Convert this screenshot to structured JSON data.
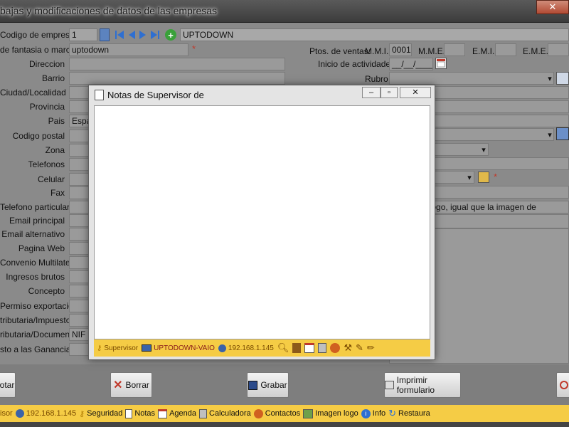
{
  "window": {
    "title": "bajas y modificaciones de datos de las empresas",
    "close": "✕"
  },
  "form": {
    "labels": {
      "codigo": "Codigo  de empresa",
      "fantasia": "de fantasia o marca",
      "direccion": "Direccion",
      "barrio": "Barrio",
      "ciudad": "Ciudad/Localidad",
      "provincia": "Provincia",
      "pais": "Pais",
      "cp": "Codigo postal",
      "zona": "Zona",
      "telefonos": "Telefonos",
      "celular": "Celular",
      "fax": "Fax",
      "tel_particular": "Telefono particular",
      "email_principal": "Email principal",
      "email_alt": "Email alternativo",
      "web": "Pagina Web",
      "convenio": "Convenio Multilateral",
      "ingresos": "Ingresos brutos",
      "concepto": "Concepto",
      "permiso": "Permiso exportacion",
      "tributaria": "tributaria/Impuesto",
      "documento": "ributaria/Documento",
      "ganancias": "sto a las Ganancias",
      "ptos": "Ptos. de ventas:",
      "mmi": "M.M.I.",
      "mme": "M.M.E.",
      "emi": "E.M.I.",
      "eme": "E.M.E.",
      "inicio": "Inicio de actividades",
      "rubro": "Rubro"
    },
    "values": {
      "codigo": "1",
      "empresa_name": "UPTODOWN",
      "fantasia": "uptodown",
      "pais": "Espa",
      "mmi": "0001",
      "fecha": "__/__/____",
      "documento": "NIF",
      "logo_text": "emplo de logo, igual que la imagen de"
    },
    "required_mark": "*"
  },
  "modal": {
    "title": "Notas de Supervisor de",
    "status": {
      "user": "Supervisor",
      "pc": "UPTODOWN-VAIO",
      "ip": "192.168.1.145"
    }
  },
  "buttons": {
    "agotar": "otar",
    "borrar": "Borrar",
    "grabar": "Grabar",
    "imprimir": "Imprimir formulario"
  },
  "statusbar": {
    "user_tail": "isor",
    "ip": "192.168.1.145",
    "seguridad": "Seguridad",
    "notas": "Notas",
    "agenda": "Agenda",
    "calculadora": "Calculadora",
    "contactos": "Contactos",
    "imagen": "Imagen logo",
    "info": "Info",
    "restaura": "Restaura"
  },
  "colors": {
    "statusbar": "#f5cc45",
    "required": "#c0392b",
    "nav_icon": "#2e6fd1"
  }
}
